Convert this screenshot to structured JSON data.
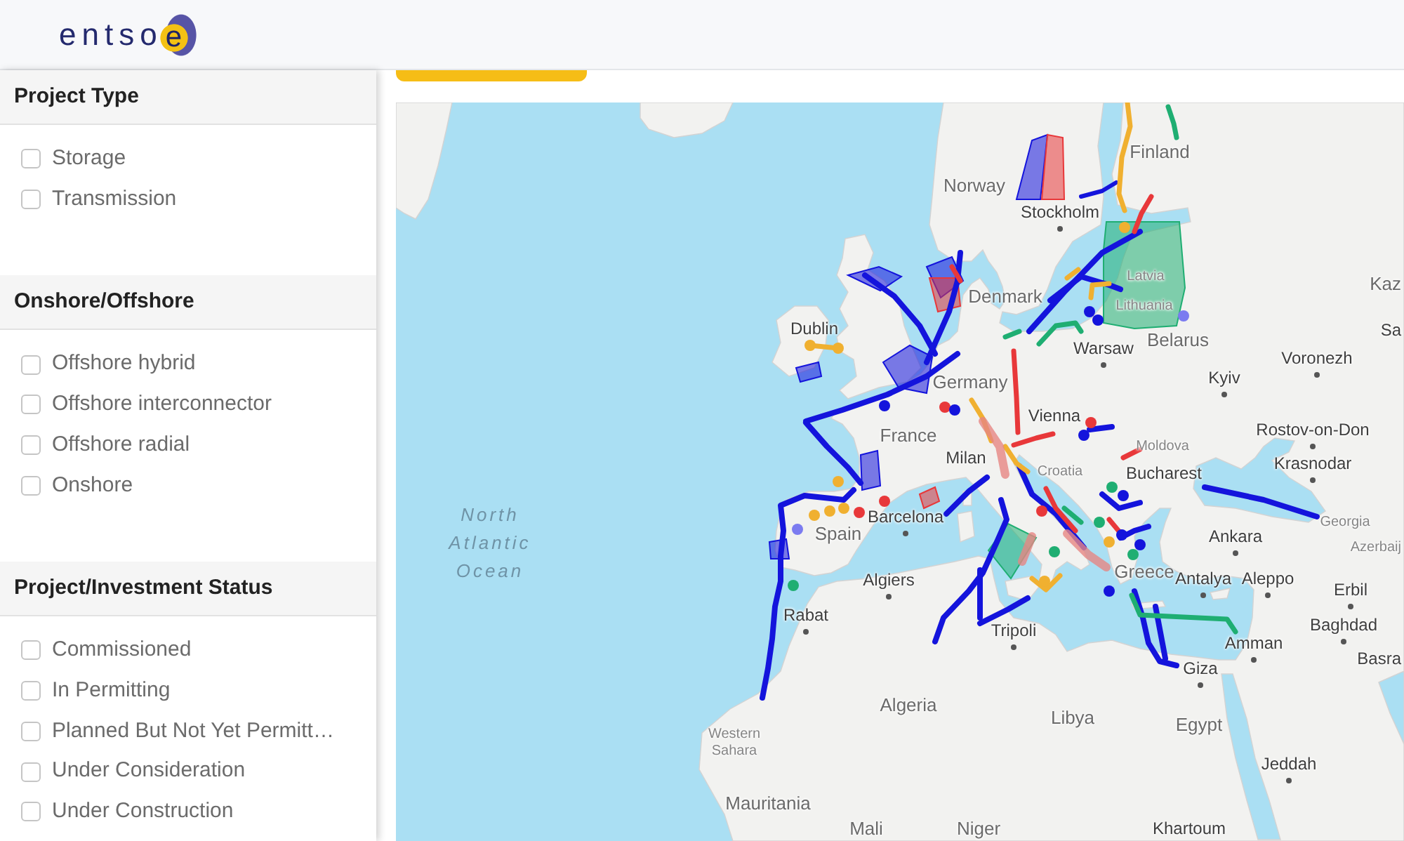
{
  "header": {
    "logo": {
      "text": "entso",
      "mark": "e"
    }
  },
  "sidebar": {
    "sections": [
      {
        "title": "Project Type",
        "options": [
          {
            "label": "Storage",
            "checked": false
          },
          {
            "label": "Transmission",
            "checked": false
          }
        ]
      },
      {
        "title": "Onshore/Offshore",
        "options": [
          {
            "label": "Offshore hybrid",
            "checked": false
          },
          {
            "label": "Offshore interconnector",
            "checked": false
          },
          {
            "label": "Offshore radial",
            "checked": false
          },
          {
            "label": "Onshore",
            "checked": false
          }
        ]
      },
      {
        "title": "Project/Investment Status",
        "options": [
          {
            "label": "Commissioned",
            "checked": false
          },
          {
            "label": "In Permitting",
            "checked": false
          },
          {
            "label": "Planned But Not Yet Permitt…",
            "checked": false
          },
          {
            "label": "Under Consideration",
            "checked": false
          },
          {
            "label": "Under Construction",
            "checked": false
          }
        ]
      }
    ]
  },
  "map": {
    "labels": [
      {
        "text": "Finland",
        "kind": "country"
      },
      {
        "text": "Norway",
        "kind": "country"
      },
      {
        "text": "Stockholm",
        "kind": "city"
      },
      {
        "text": "Latvia",
        "kind": "minor"
      },
      {
        "text": "Kaz",
        "kind": "country"
      },
      {
        "text": "Denmark",
        "kind": "country"
      },
      {
        "text": "Lithuania",
        "kind": "minor"
      },
      {
        "text": "Dublin",
        "kind": "place"
      },
      {
        "text": "Sa",
        "kind": "place"
      },
      {
        "text": "Warsaw",
        "kind": "city"
      },
      {
        "text": "Belarus",
        "kind": "country"
      },
      {
        "text": "Voronezh",
        "kind": "city"
      },
      {
        "text": "Germany",
        "kind": "country"
      },
      {
        "text": "Kyiv",
        "kind": "city"
      },
      {
        "text": "Vienna",
        "kind": "place"
      },
      {
        "text": "France",
        "kind": "country"
      },
      {
        "text": "Rostov-on-Don",
        "kind": "city"
      },
      {
        "text": "Moldova",
        "kind": "minor"
      },
      {
        "text": "Milan",
        "kind": "place"
      },
      {
        "text": "Krasnodar",
        "kind": "city"
      },
      {
        "text": "Croatia",
        "kind": "minor"
      },
      {
        "text": "Bucharest",
        "kind": "place"
      },
      {
        "text": "North Atlantic Ocean",
        "kind": "ocean"
      },
      {
        "text": "Barcelona",
        "kind": "city"
      },
      {
        "text": "Georgia",
        "kind": "minor"
      },
      {
        "text": "Spain",
        "kind": "country"
      },
      {
        "text": "Ankara",
        "kind": "city"
      },
      {
        "text": "Azerbaij",
        "kind": "minor"
      },
      {
        "text": "Algiers",
        "kind": "city"
      },
      {
        "text": "Greece",
        "kind": "country"
      },
      {
        "text": "Antalya",
        "kind": "city"
      },
      {
        "text": "Aleppo",
        "kind": "city"
      },
      {
        "text": "Erbil",
        "kind": "city"
      },
      {
        "text": "Rabat",
        "kind": "city"
      },
      {
        "text": "Tripoli",
        "kind": "city"
      },
      {
        "text": "Baghdad",
        "kind": "city"
      },
      {
        "text": "Amman",
        "kind": "city"
      },
      {
        "text": "Giza",
        "kind": "city"
      },
      {
        "text": "Basra",
        "kind": "place"
      },
      {
        "text": "Algeria",
        "kind": "country"
      },
      {
        "text": "Libya",
        "kind": "country"
      },
      {
        "text": "Egypt",
        "kind": "country"
      },
      {
        "text": "Western Sahara",
        "kind": "minor"
      },
      {
        "text": "Jeddah",
        "kind": "city"
      },
      {
        "text": "Mauritania",
        "kind": "country"
      },
      {
        "text": "Mali",
        "kind": "country"
      },
      {
        "text": "Niger",
        "kind": "country"
      },
      {
        "text": "Khartoum",
        "kind": "place"
      }
    ]
  }
}
